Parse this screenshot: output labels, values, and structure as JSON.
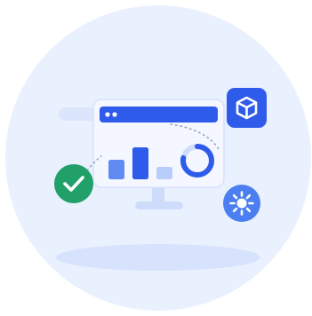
{
  "illustration": {
    "kind": "dashboard-monitor-illustration",
    "colors": {
      "backdrop": "#eaf1fe",
      "monitor_bg": "#f4f7ff",
      "monitor_border": "#dbe6fd",
      "accent": "#2e5bea",
      "bar_dark": "#2e5bea",
      "bar_mid": "#5f8bf3",
      "bar_light": "#b9cdfb",
      "stand": "#cddcfb",
      "success": "#21a06a",
      "sun_badge": "#4b7ef0",
      "cube_badge": "#2e5bea",
      "shadow": "#d7e3fc"
    },
    "window_dots": 2,
    "bars": [
      {
        "level": 0.45
      },
      {
        "level": 0.75
      },
      {
        "level": 0.3
      }
    ],
    "donut_progress": 0.78,
    "icons": [
      "cube-icon",
      "check-icon",
      "sun-icon"
    ]
  }
}
